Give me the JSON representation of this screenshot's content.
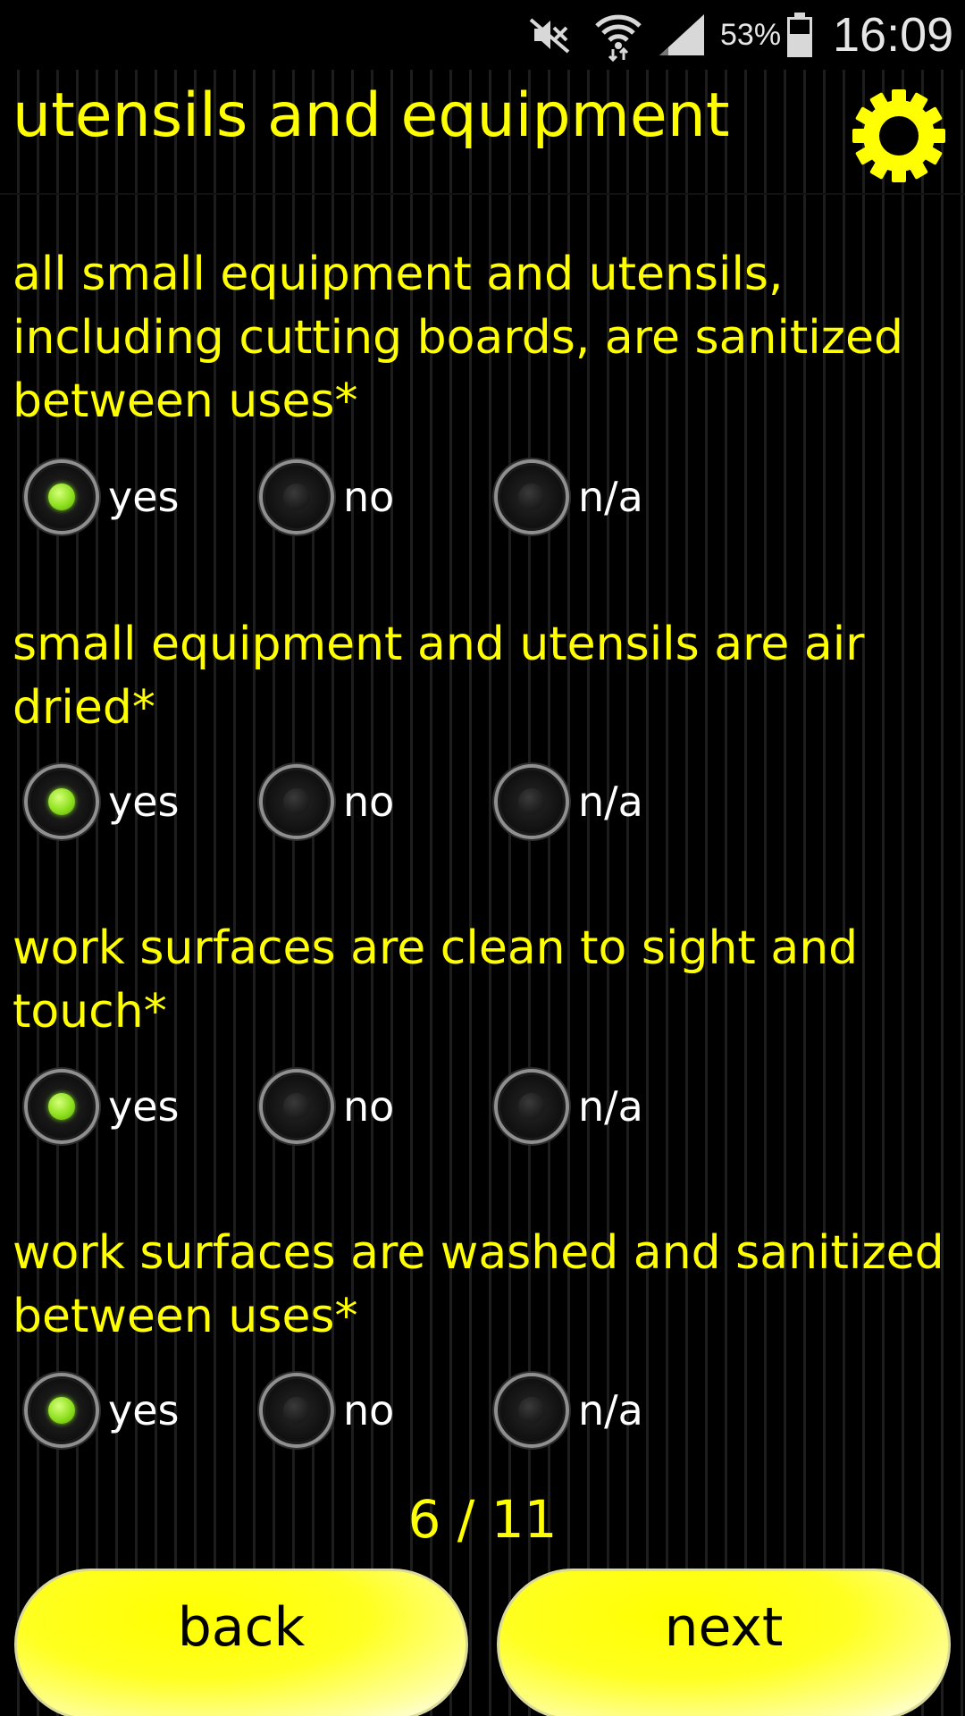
{
  "status_bar": {
    "battery_percent": "53%",
    "time": "16:09",
    "icons": [
      "mute-icon",
      "wifi-icon",
      "signal-icon",
      "battery-icon"
    ]
  },
  "header": {
    "title": "utensils and equipment",
    "settings_icon": "gear-icon"
  },
  "questions": [
    {
      "text": "all small equipment and utensils, including cutting boards, are sanitized between uses*",
      "options": [
        "yes",
        "no",
        "n/a"
      ],
      "selected": "yes"
    },
    {
      "text": "small equipment and utensils are air dried*",
      "options": [
        "yes",
        "no",
        "n/a"
      ],
      "selected": "yes"
    },
    {
      "text": "work surfaces are clean to sight and touch*",
      "options": [
        "yes",
        "no",
        "n/a"
      ],
      "selected": "yes"
    },
    {
      "text": "work surfaces are washed and sanitized between uses*",
      "options": [
        "yes",
        "no",
        "n/a"
      ],
      "selected": "yes"
    }
  ],
  "pagination": {
    "indicator": "6 / 11",
    "back_label": "back",
    "next_label": "next"
  },
  "colors": {
    "accent": "#ffff00",
    "background": "#000000",
    "selected_radio": "#8ee01f",
    "option_text": "#ffffff"
  }
}
